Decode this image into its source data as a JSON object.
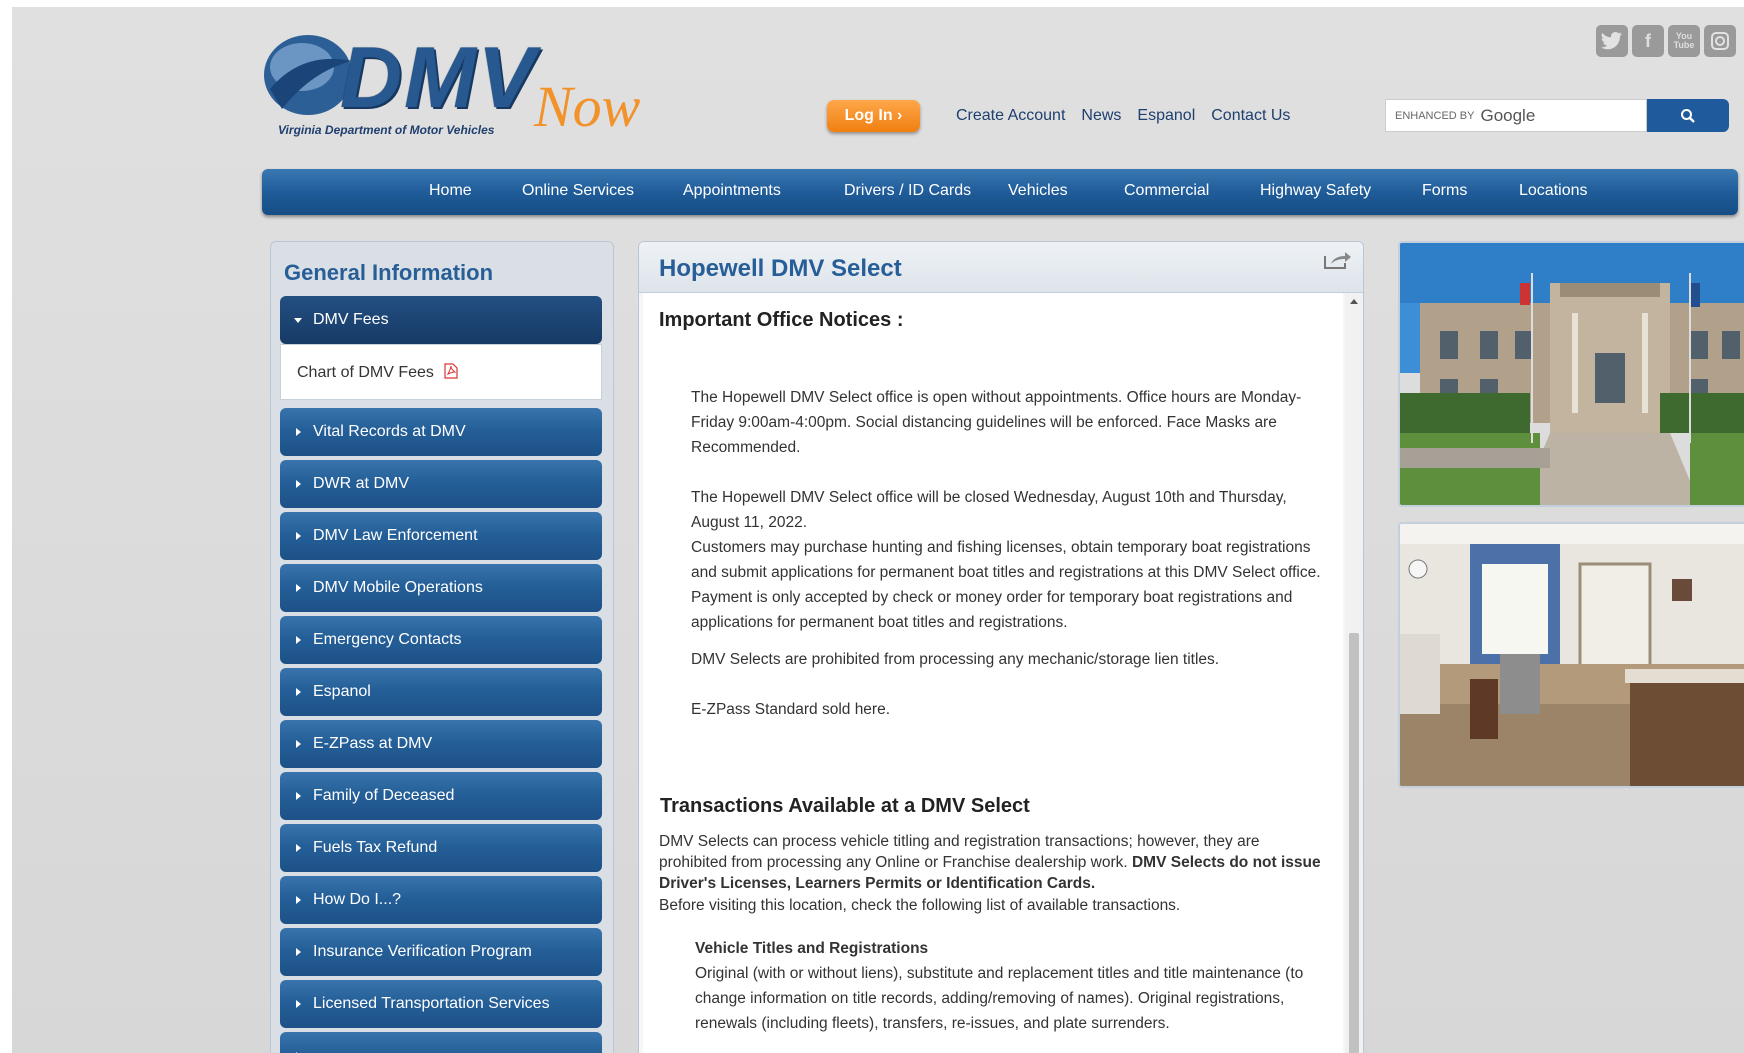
{
  "logo": {
    "main": "DMV",
    "now": "Now",
    "tagline": "Virginia Department of Motor Vehicles"
  },
  "header": {
    "login_label": "Log In ›",
    "links": [
      "Create Account",
      "News",
      "Espanol",
      "Contact Us"
    ],
    "social": [
      "twitter-icon",
      "facebook-icon",
      "youtube-icon",
      "instagram-icon"
    ],
    "search": {
      "enhanced_by": "ENHANCED BY",
      "google": "Google",
      "value": ""
    }
  },
  "nav": [
    "Home",
    "Online Services",
    "Appointments",
    "Drivers / ID Cards",
    "Vehicles",
    "Commercial",
    "Highway Safety",
    "Forms",
    "Locations"
  ],
  "sidebar": {
    "heading": "General Information",
    "open_item": "DMV Fees",
    "sub_item": "Chart of DMV Fees",
    "items": [
      "Vital Records at DMV",
      "DWR at DMV",
      "DMV Law Enforcement",
      "DMV Mobile Operations",
      "Emergency Contacts",
      "Espanol",
      "E-ZPass at DMV",
      "Family of Deceased",
      "Fuels Tax Refund",
      "How Do I...?",
      "Insurance Verification Program",
      "Licensed Transportation Services"
    ]
  },
  "page": {
    "title": "Hopewell DMV Select",
    "notices_heading": "Important Office Notices :",
    "notice1": "The Hopewell DMV Select office is open without appointments. Office hours are Monday-Friday 9:00am-4:00pm. Social distancing guidelines will be enforced. Face Masks are Recommended.",
    "notice2": "The Hopewell DMV Select office will be closed Wednesday, August 10th and Thursday, August 11, 2022.",
    "notice3": "Customers may purchase hunting and fishing licenses, obtain temporary boat registrations and submit applications for permanent boat titles and registrations at this DMV Select office. Payment is only accepted by check or money order for temporary boat registrations and applications for permanent boat titles and registrations.",
    "notice4": "DMV Selects are prohibited from processing any mechanic/storage lien titles.",
    "notice5": "E-ZPass Standard sold here.",
    "transactions_heading": "Transactions Available at a DMV Select",
    "transactions_intro": "DMV Selects can process vehicle titling and registration transactions; however, they are prohibited from processing any Online or Franchise dealership work.",
    "transactions_bold": "DMV Selects do not issue Driver's Licenses, Learners Permits or Identification Cards.",
    "before_visiting": "Before visiting this location, check the following list of available transactions.",
    "vtr_heading": "Vehicle Titles and Registrations",
    "vtr_text": "Original (with or without liens), substitute and replacement titles and title maintenance (to change information on title records, adding/removing of names). Original registrations, renewals (including fleets), transfers, re-issues, and plate surrenders."
  },
  "colors": {
    "brand_blue": "#255f98",
    "accent_orange": "#f07f10",
    "notice_red": "#e02020"
  }
}
